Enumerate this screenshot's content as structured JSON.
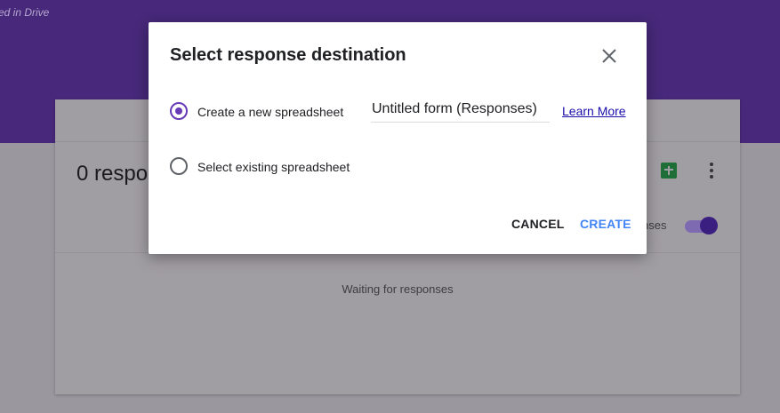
{
  "background": {
    "saved_text": "ed in Drive",
    "responses_title": "0 respo",
    "accepting_label": "nses",
    "waiting_text": "Waiting for responses",
    "icons": [
      "sheets-icon",
      "more-vert-icon"
    ]
  },
  "dialog": {
    "title": "Select response destination",
    "close_icon": "close-icon",
    "options": [
      {
        "label": "Create a new spreadsheet",
        "selected": true
      },
      {
        "label": "Select existing spreadsheet",
        "selected": false
      }
    ],
    "spreadsheet_name": "Untitled form (Responses)",
    "learn_more": "Learn More",
    "cancel_label": "CANCEL",
    "create_label": "CREATE"
  },
  "colors": {
    "header": "#47287a",
    "accent": "#673ab7",
    "create": "#4285f4",
    "link": "#1a0dab"
  }
}
